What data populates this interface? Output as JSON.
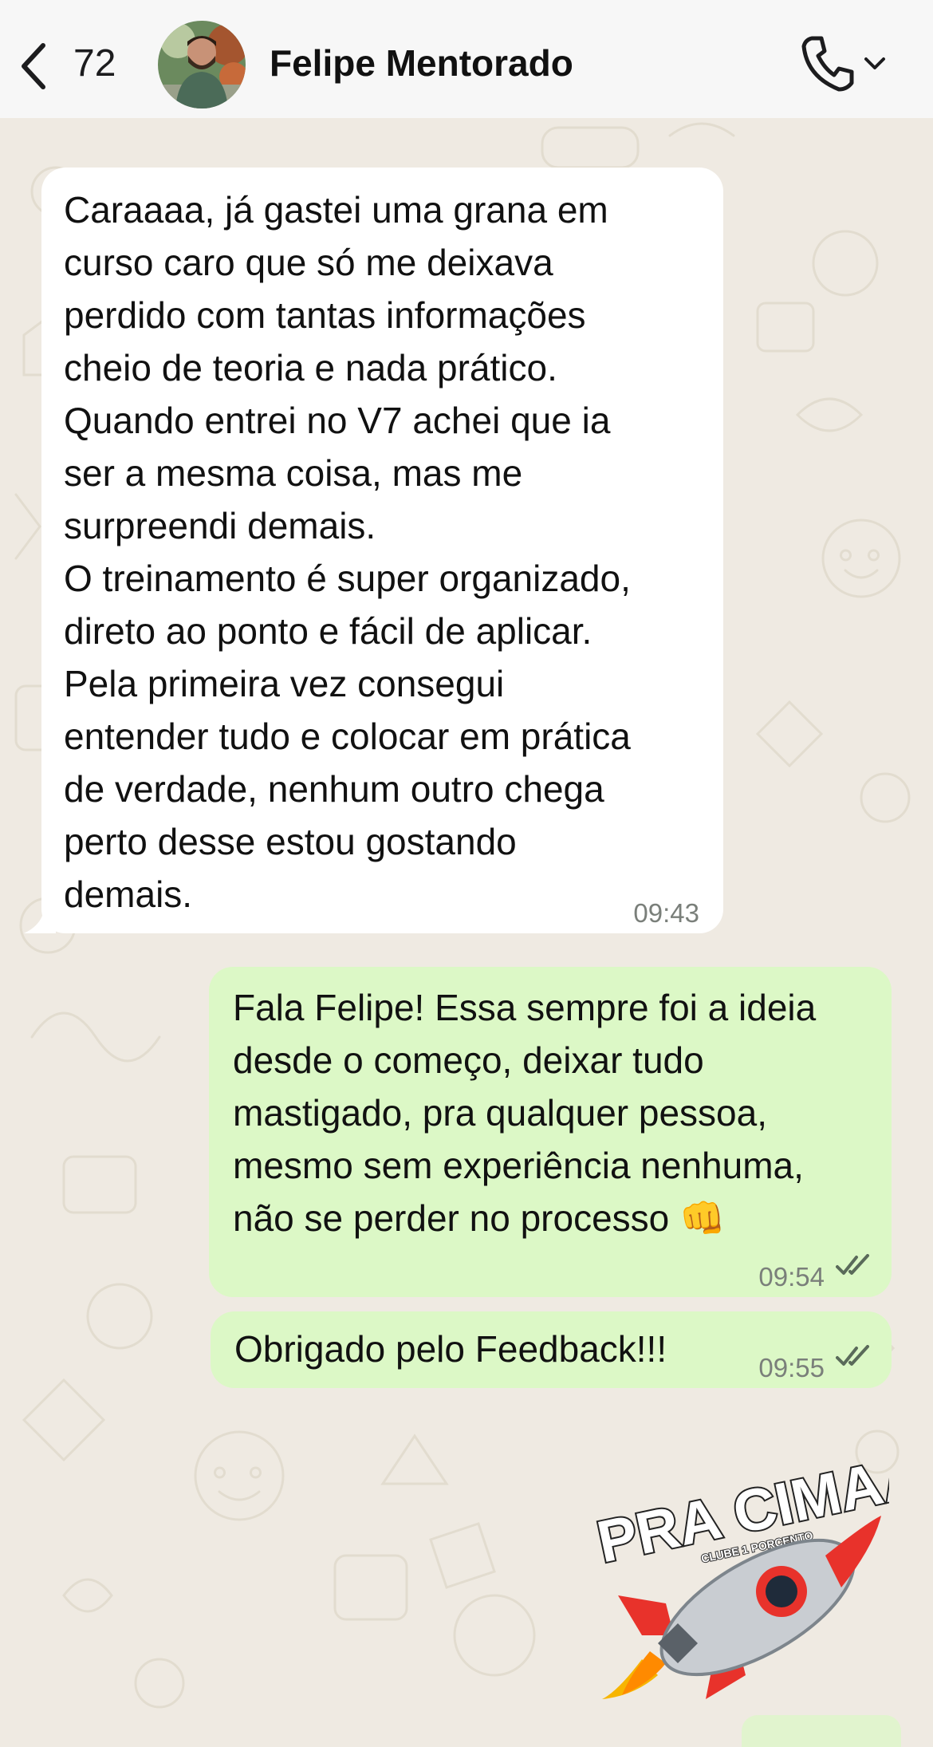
{
  "header": {
    "back_count": "72",
    "contact_name": "Felipe Mentorado"
  },
  "messages": [
    {
      "direction": "incoming",
      "text": "Caraaaa, já gastei uma grana em\ncurso caro que só me deixava\nperdido com tantas informações\ncheio de teoria e nada prático.\nQuando entrei no V7 achei que ia\nser a mesma coisa, mas me\nsurpreendi demais.\nO treinamento é super organizado,\ndireto ao ponto e fácil de aplicar.\nPela primeira vez consegui\nentender tudo e colocar em prática\nde verdade, nenhum outro chega\nperto desse estou gostando\ndemais.",
      "time": "09:43"
    },
    {
      "direction": "outgoing",
      "text": "Fala Felipe! Essa sempre foi a ideia\ndesde o começo, deixar tudo\nmastigado, pra qualquer pessoa,\nmesmo sem experiência nenhuma,\nnão se perder no processo 👊",
      "time": "09:54",
      "status": "read"
    },
    {
      "direction": "outgoing",
      "text": "Obrigado pelo Feedback!!!",
      "time": "09:55",
      "status": "read"
    }
  ],
  "sticker": {
    "text": "PRA CIMAAA!",
    "subtext": "CLUBE 1 PORCENTO",
    "icon": "rocket-icon"
  },
  "colors": {
    "incoming_bubble": "#ffffff",
    "outgoing_bubble": "#dcf8c6",
    "background": "#efeae2",
    "read_ticks": "#5a6a5a"
  }
}
